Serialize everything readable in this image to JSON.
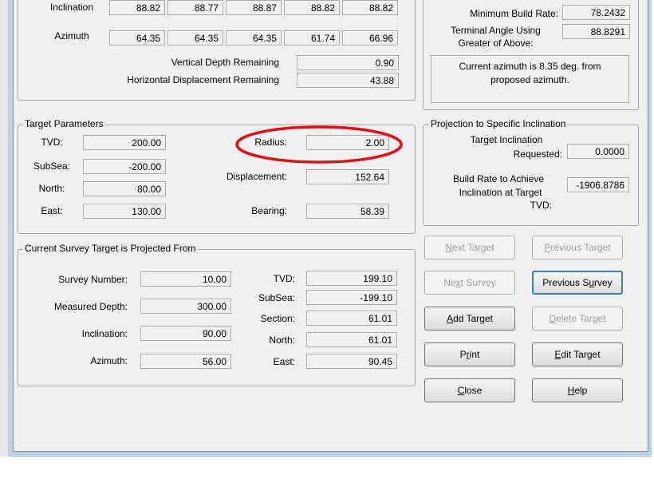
{
  "top_table": {
    "inclination_label": "Inclination",
    "inclination_values": [
      "88.82",
      "88.77",
      "88.87",
      "88.82",
      "88.82"
    ],
    "azimuth_label": "Azimuth",
    "azimuth_values": [
      "64.35",
      "64.35",
      "64.35",
      "61.74",
      "66.96"
    ],
    "vertical_depth_remaining_label": "Vertical Depth Remaining",
    "vertical_depth_remaining": "0.90",
    "horizontal_displacement_remaining_label": "Horizontal Displacement Remaining",
    "horizontal_displacement_remaining": "43.88"
  },
  "build_rate": {
    "minimum_build_rate_label": "Minimum Build Rate:",
    "minimum_build_rate": "78.2432",
    "terminal_angle_label_1": "Terminal Angle Using",
    "terminal_angle_label_2": "Greater of Above:",
    "terminal_angle": "88.8291",
    "message_line_1": "Current azimuth is 8.35 deg. from",
    "message_line_2": "proposed azimuth."
  },
  "target_parameters": {
    "legend": "Target Parameters",
    "tvd_label": "TVD:",
    "tvd": "200.00",
    "subsea_label": "SubSea:",
    "subsea": "-200.00",
    "north_label": "North:",
    "north": "80.00",
    "east_label": "East:",
    "east": "130.00",
    "radius_label": "Radius:",
    "radius": "2.00",
    "displacement_label": "Displacement:",
    "displacement": "152.64",
    "bearing_label": "Bearing:",
    "bearing": "58.39"
  },
  "projection": {
    "legend": "Projection to Specific Inclination",
    "target_inclination_label_1": "Target Inclination",
    "target_inclination_label_2": "Requested:",
    "target_inclination": "0.0000",
    "build_rate_label_1": "Build Rate to Achieve",
    "build_rate_label_2": "Inclination at Target",
    "build_rate_label_3": "TVD:",
    "build_rate": "-1906.8786"
  },
  "survey": {
    "legend": "Current Survey Target is Projected From",
    "survey_number_label": "Survey Number:",
    "survey_number": "10.00",
    "measured_depth_label": "Measured Depth:",
    "measured_depth": "300.00",
    "inclination_label": "Inclination:",
    "inclination": "90.00",
    "azimuth_label": "Azimuth:",
    "azimuth": "56.00",
    "tvd_label": "TVD:",
    "tvd": "199.10",
    "subsea_label": "SubSea:",
    "subsea": "-199.10",
    "section_label": "Section:",
    "section": "61.01",
    "north_label": "North:",
    "north": "61.01",
    "east_label": "East:",
    "east": "90.45"
  },
  "buttons": {
    "next_target": {
      "pre": "",
      "key": "N",
      "post": "ext Target"
    },
    "previous_target": {
      "pre": "",
      "key": "P",
      "post": "revious Target"
    },
    "next_survey": {
      "pre": "Ne",
      "key": "x",
      "post": "t Survey"
    },
    "previous_survey": {
      "pre": "Previous S",
      "key": "u",
      "post": "rvey"
    },
    "add_target": {
      "pre": "",
      "key": "A",
      "post": "dd Target"
    },
    "delete_target": {
      "pre": "",
      "key": "D",
      "post": "elete Target"
    },
    "print": {
      "pre": "P",
      "key": "r",
      "post": "int"
    },
    "edit_target": {
      "pre": "",
      "key": "E",
      "post": "dit Target"
    },
    "close": {
      "pre": "",
      "key": "C",
      "post": "lose"
    },
    "help": {
      "pre": "",
      "key": "H",
      "post": "elp"
    }
  },
  "colors": {
    "annotation_ellipse": "#e0101a",
    "window_frame": "#b9d1ea",
    "dialog_background": "#f0f0f0"
  }
}
